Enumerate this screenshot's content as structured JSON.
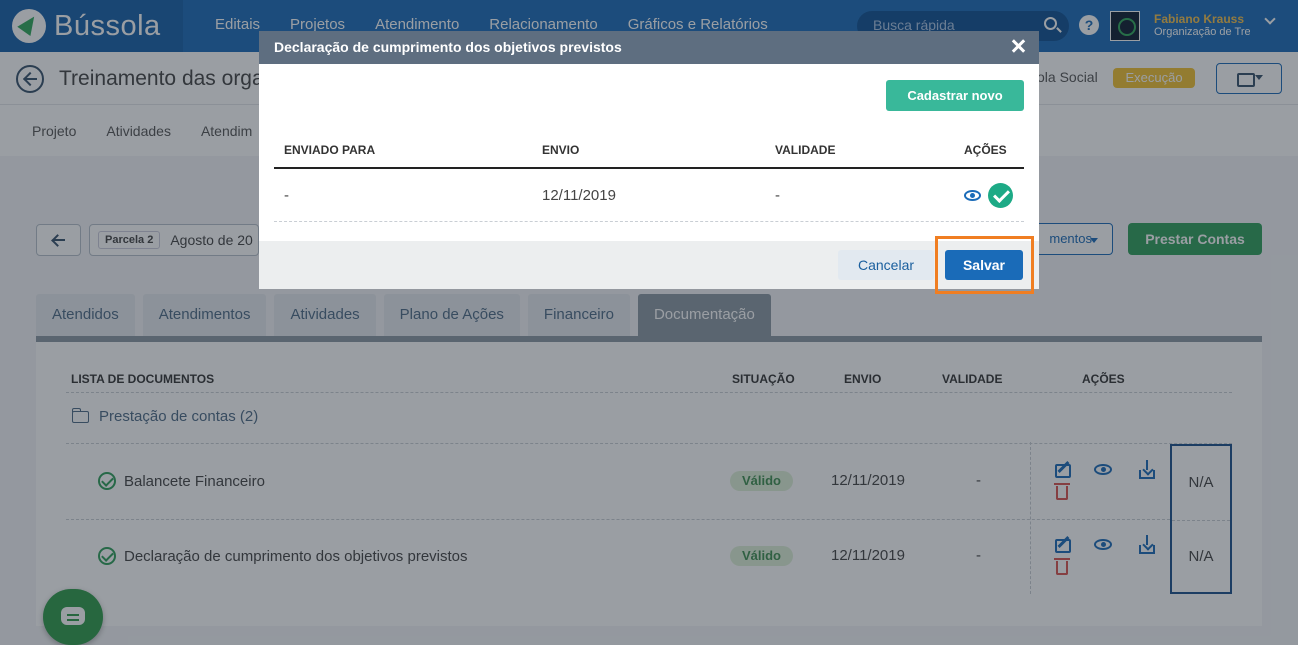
{
  "brand": {
    "name": "Bússola"
  },
  "nav": {
    "items": [
      "Editais",
      "Projetos",
      "Atendimento",
      "Relacionamento",
      "Gráficos e Relatórios"
    ]
  },
  "search": {
    "placeholder": "Busca rápida"
  },
  "user": {
    "name": "Fabiano Krauss",
    "org": "Organização de Tre"
  },
  "header": {
    "title": "Treinamento das orga",
    "subtitle": "ola Social",
    "status": "Execução"
  },
  "subnav": {
    "items": [
      "Projeto",
      "Atividades",
      "Atendim"
    ]
  },
  "parcela": {
    "tag": "Parcela 2",
    "value": "Agosto de 20"
  },
  "actions": {
    "documents": "mentos",
    "prestar": "Prestar Contas"
  },
  "tabs": [
    "Atendidos",
    "Atendimentos",
    "Atividades",
    "Plano de Ações",
    "Financeiro",
    "Documentação"
  ],
  "docs": {
    "headers": {
      "lista": "LISTA DE DOCUMENTOS",
      "situacao": "SITUAÇÃO",
      "envio": "ENVIO",
      "validade": "VALIDADE",
      "acoes": "AÇÕES"
    },
    "folder": "Prestação de contas (2)",
    "rows": [
      {
        "name": "Balancete Financeiro",
        "status": "Válido",
        "envio": "12/11/2019",
        "validade": "-",
        "na": "N/A"
      },
      {
        "name": "Declaração de cumprimento dos objetivos previstos",
        "status": "Válido",
        "envio": "12/11/2019",
        "validade": "-",
        "na": "N/A"
      }
    ]
  },
  "modal": {
    "title": "Declaração de cumprimento dos objetivos previstos",
    "new_button": "Cadastrar novo",
    "headers": {
      "enviado": "ENVIADO PARA",
      "envio": "ENVIO",
      "validade": "VALIDADE",
      "acoes": "AÇÕES"
    },
    "row": {
      "enviado": "-",
      "envio": "12/11/2019",
      "validade": "-"
    },
    "cancel": "Cancelar",
    "save": "Salvar"
  },
  "colors": {
    "primary": "#1a6bb8",
    "success": "#2f9e5a",
    "highlight": "#f07e22"
  }
}
